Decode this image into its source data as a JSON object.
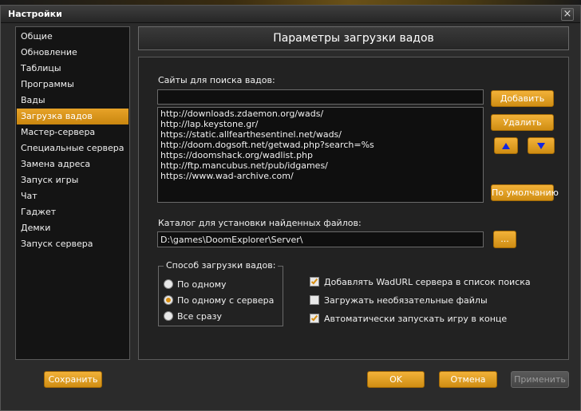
{
  "window": {
    "title": "Настройки",
    "close_icon": "close-icon",
    "close_glyph": "×"
  },
  "sidebar": {
    "items": [
      {
        "label": "Общие",
        "active": false
      },
      {
        "label": "Обновление",
        "active": false
      },
      {
        "label": "Таблицы",
        "active": false
      },
      {
        "label": "Программы",
        "active": false
      },
      {
        "label": "Вады",
        "active": false
      },
      {
        "label": "Загрузка вадов",
        "active": true
      },
      {
        "label": "Мастер-сервера",
        "active": false
      },
      {
        "label": "Специальные сервера",
        "active": false
      },
      {
        "label": "Замена адреса",
        "active": false
      },
      {
        "label": "Запуск игры",
        "active": false
      },
      {
        "label": "Чат",
        "active": false
      },
      {
        "label": "Гаджет",
        "active": false
      },
      {
        "label": "Демки",
        "active": false
      },
      {
        "label": "Запуск сервера",
        "active": false
      }
    ]
  },
  "panel": {
    "title": "Параметры загрузки вадов",
    "sites_label": "Сайты для поиска вадов:",
    "site_input_value": "",
    "sites": [
      "http://downloads.zdaemon.org/wads/",
      "http://lap.keystone.gr/",
      "https://static.allfearthesentinel.net/wads/",
      "http://doom.dogsoft.net/getwad.php?search=%s",
      "https://doomshack.org/wadlist.php",
      "http://ftp.mancubus.net/pub/idgames/",
      "https://www.wad-archive.com/"
    ],
    "add_label": "Добавить",
    "remove_label": "Удалить",
    "move_up_icon": "arrow-up-icon",
    "move_down_icon": "arrow-down-icon",
    "default_label": "По умолчанию",
    "dir_label": "Каталог для установки найденных файлов:",
    "dir_value": "D:\\games\\DoomExplorer\\Server\\",
    "browse_label": "...",
    "mode_group": {
      "title": "Способ загрузки вадов:",
      "options": [
        {
          "label": "По одному",
          "selected": false
        },
        {
          "label": "По одному с сервера",
          "selected": true
        },
        {
          "label": "Все сразу",
          "selected": false
        }
      ]
    },
    "checks": [
      {
        "label": "Добавлять WadURL сервера в список поиска",
        "checked": true
      },
      {
        "label": "Загружать необязательные файлы",
        "checked": false
      },
      {
        "label": "Автоматически запускать игру в конце",
        "checked": true
      }
    ]
  },
  "footer": {
    "save_label": "Сохранить",
    "ok_label": "OK",
    "cancel_label": "Отмена",
    "apply_label": "Применить"
  },
  "colors": {
    "accent": "#e0a024",
    "background": "#2b2b2b",
    "disabled_button": "#505050"
  }
}
